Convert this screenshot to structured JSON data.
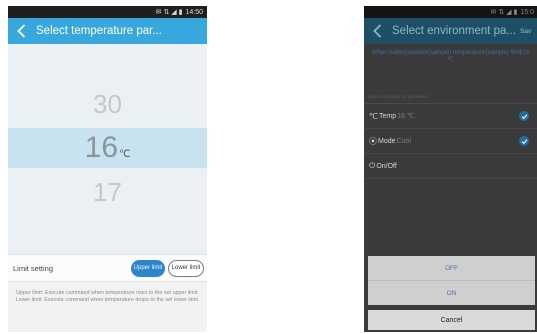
{
  "phone1": {
    "status_time": "14:50",
    "status_icons": "✉ ⇅ ◢ ▮",
    "title": "Select temperature par...",
    "picker": {
      "above": "30",
      "selected": "16",
      "unit": "℃",
      "below": "17"
    },
    "limit": {
      "label": "Limit setting",
      "upper_label": "Upper limit",
      "lower_label": "Lower limit",
      "selected": "upper"
    },
    "help_upper": "Upper limit: Execute command when temperature rises to the set upper limit.",
    "help_lower": "Lower limit: Execute command when temperature drops to the set lower limit."
  },
  "phone2": {
    "status_time": "15:0",
    "status_icons": "✉ ⇅ ◢ ▮",
    "title": "Select environment pa...",
    "save_label": "Sav",
    "when_text": "When batteryoutdoor(sample) temperature(sample) $%$16 ℃",
    "subheader": "Select environment parameter",
    "rows": [
      {
        "icon": "℃",
        "label": "Temp",
        "value": "16 ℃",
        "checked": true
      },
      {
        "icon": "⦿",
        "label": "Mode",
        "value": "Cool",
        "checked": true
      },
      {
        "icon": "⏻",
        "label": "On/Off",
        "value": "",
        "checked": false
      }
    ],
    "dialog": {
      "off_label": "OFF",
      "on_label": "ON",
      "cancel_label": "Cancel"
    }
  },
  "colors": {
    "action_bar_1": "#37a7dd",
    "action_bar_2": "#1f4f66",
    "picker_highlight": "#c7e3f0",
    "upper_button": "#2d86cb",
    "check": "#1f6ea3"
  }
}
